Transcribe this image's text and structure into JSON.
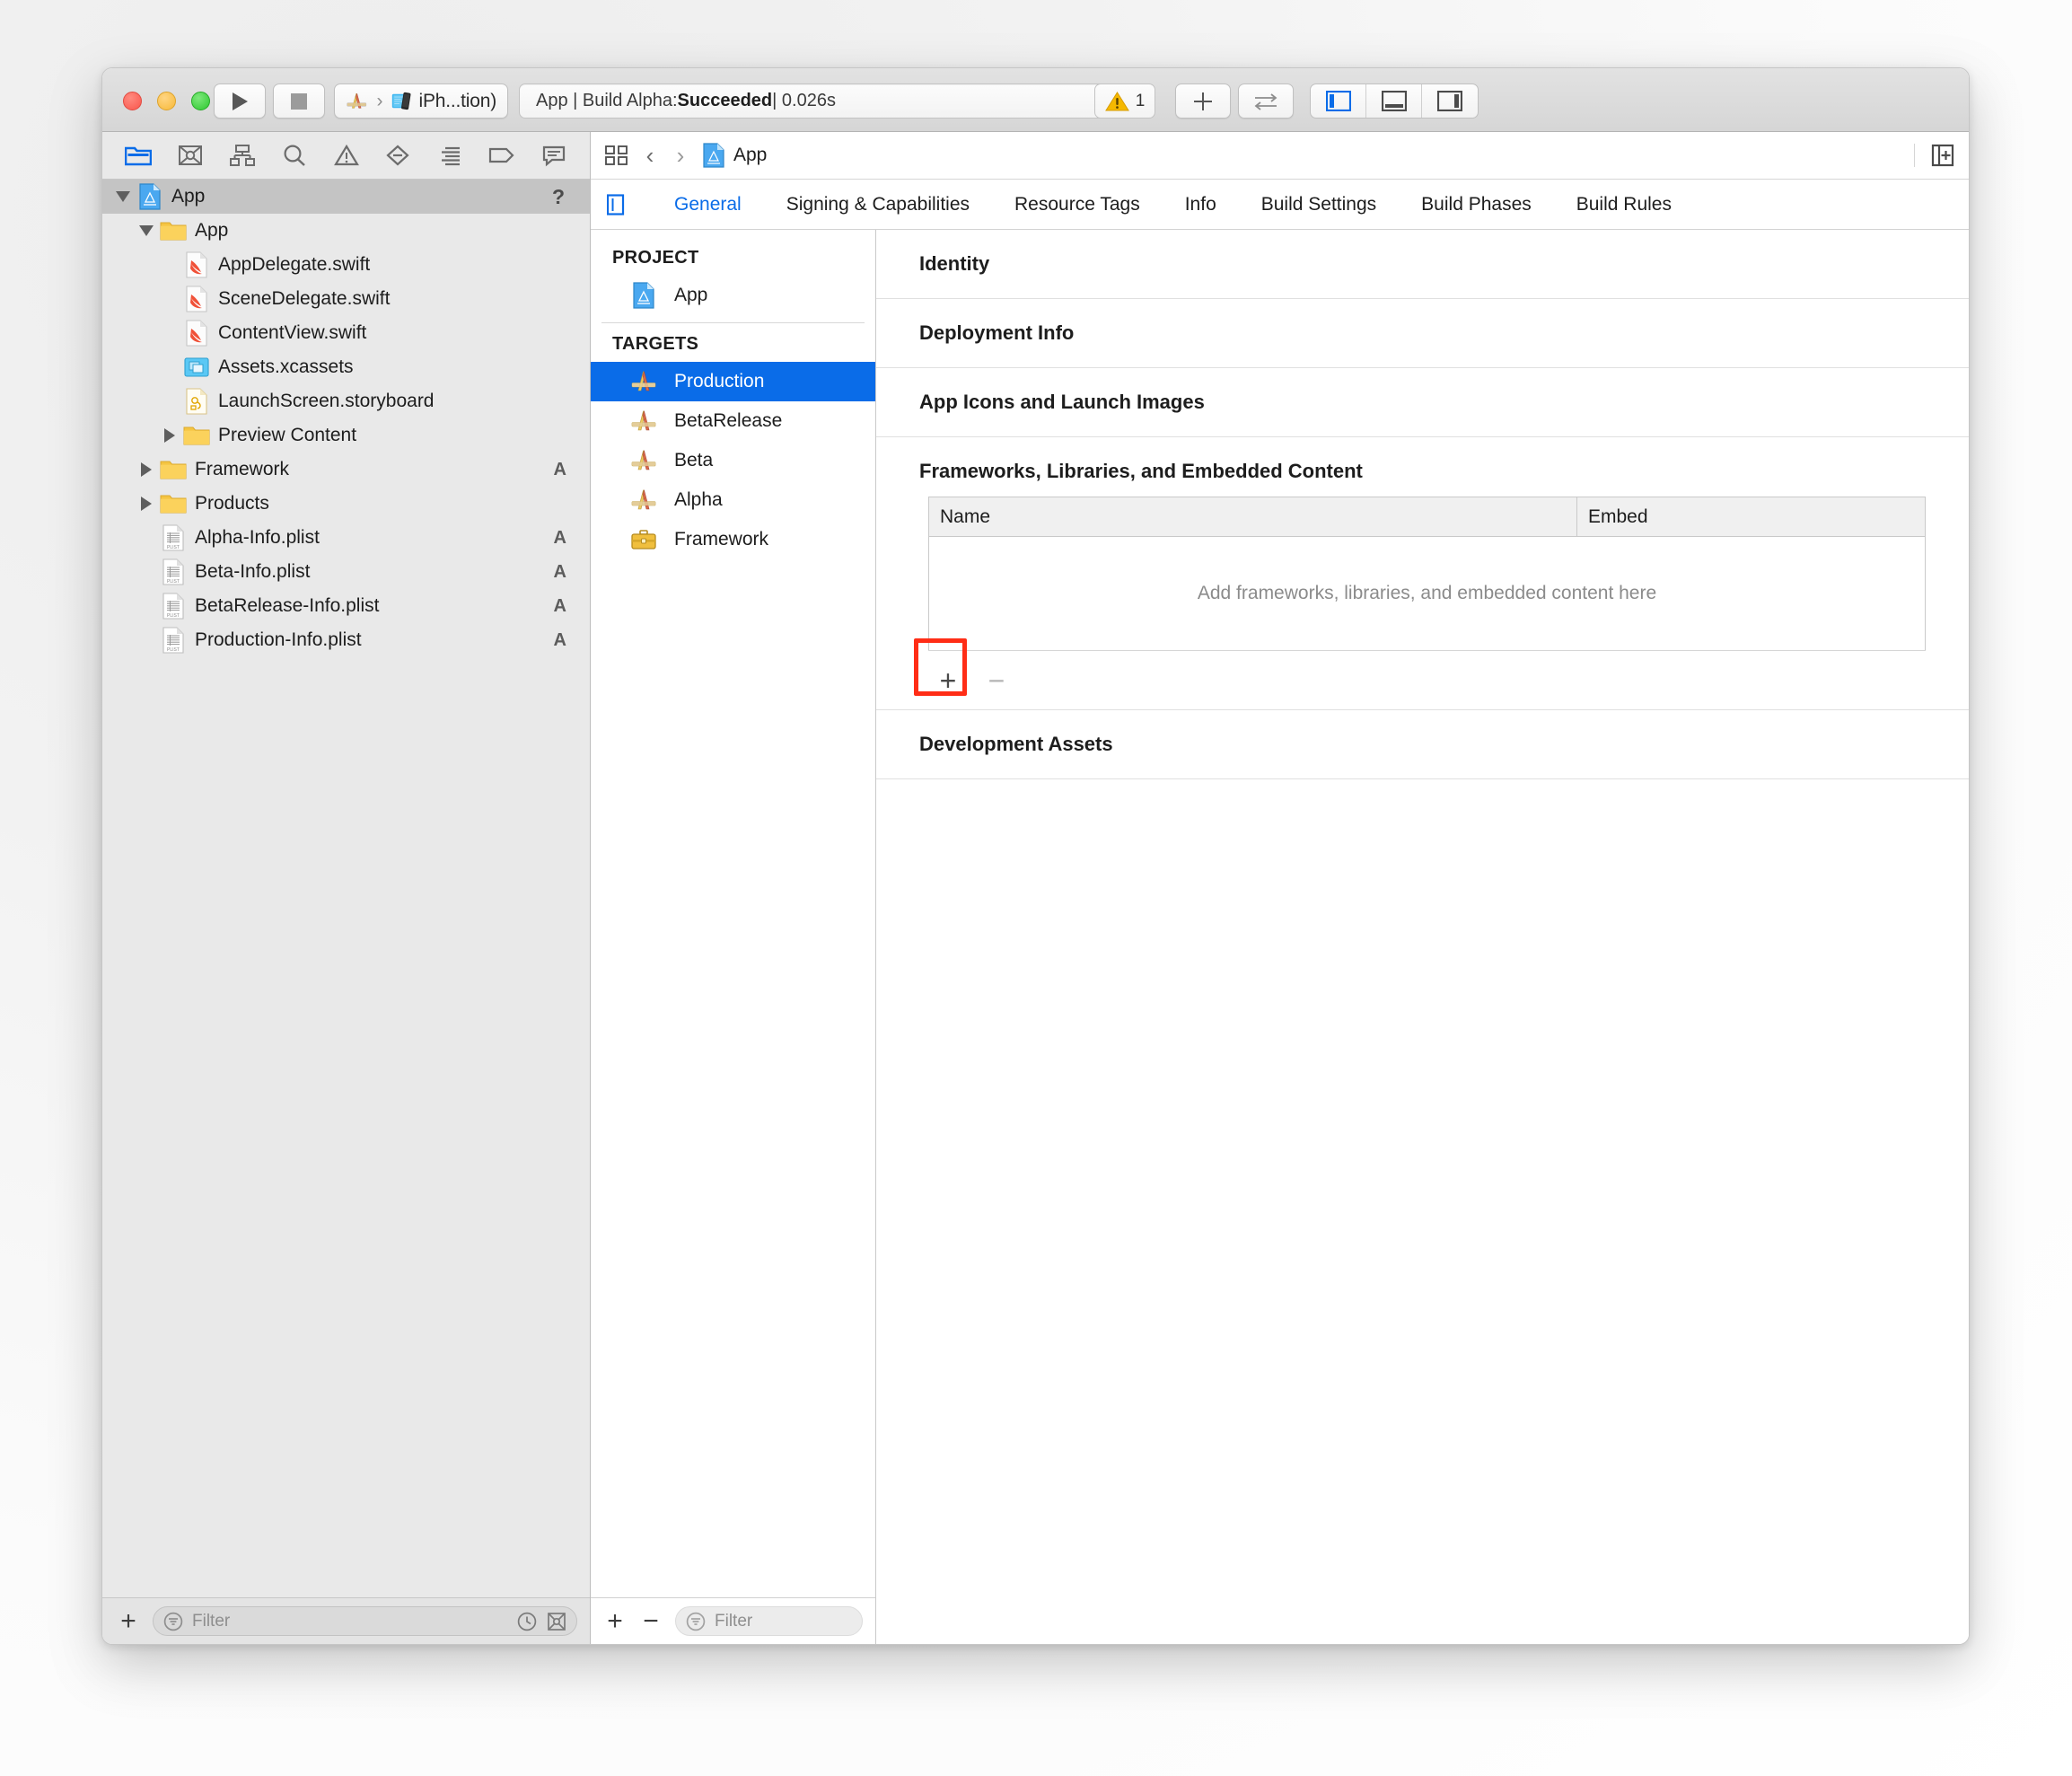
{
  "window": {
    "traffic_lights": [
      "close",
      "minimize",
      "zoom"
    ],
    "toolbar": {
      "run_label": "Run",
      "stop_label": "Stop",
      "scheme_label": "iPh...tion)",
      "scheme_icon": "xcode-scheme-icon",
      "destination_icon": "iphone-simulator-icon",
      "status_prefix": "App | Build Alpha: ",
      "status_result": "Succeeded",
      "status_suffix": " | 0.026s",
      "warning_count": "1",
      "add_label": "+",
      "swap_label": "⇄",
      "panel_left_label": "Navigator",
      "panel_bottom_label": "Debug Area",
      "panel_right_label": "Inspector",
      "accent_blue": "#0a6ce8",
      "warning_yellow": "#f5b800"
    }
  },
  "navigator": {
    "icons": [
      {
        "name": "folder-icon",
        "label": "Project Navigator",
        "active": true
      },
      {
        "name": "sourcecontrol-icon",
        "label": "Source Control Navigator",
        "active": false
      },
      {
        "name": "hierarchy-icon",
        "label": "Symbol Navigator",
        "active": false
      },
      {
        "name": "search-icon",
        "label": "Find Navigator",
        "active": false
      },
      {
        "name": "warning-triangle-icon",
        "label": "Issue Navigator",
        "active": false
      },
      {
        "name": "diamond-minus-icon",
        "label": "Test Navigator",
        "active": false
      },
      {
        "name": "lines-icon",
        "label": "Debug Navigator",
        "active": false
      },
      {
        "name": "tag-icon",
        "label": "Breakpoint Navigator",
        "active": false
      },
      {
        "name": "speech-bubble-icon",
        "label": "Report Navigator",
        "active": false
      }
    ],
    "tree": [
      {
        "label": "App",
        "icon": "xcodeproj-icon",
        "indent": 0,
        "twisty": "down",
        "selected": true,
        "badge": "?",
        "badge_kind": "help"
      },
      {
        "label": "App",
        "icon": "folder-yellow-icon",
        "indent": 1,
        "twisty": "down",
        "selected": false,
        "badge": ""
      },
      {
        "label": "AppDelegate.swift",
        "icon": "swift-file-icon",
        "indent": 2,
        "twisty": "none",
        "selected": false,
        "badge": ""
      },
      {
        "label": "SceneDelegate.swift",
        "icon": "swift-file-icon",
        "indent": 2,
        "twisty": "none",
        "selected": false,
        "badge": ""
      },
      {
        "label": "ContentView.swift",
        "icon": "swift-file-icon",
        "indent": 2,
        "twisty": "none",
        "selected": false,
        "badge": ""
      },
      {
        "label": "Assets.xcassets",
        "icon": "xcassets-icon",
        "indent": 2,
        "twisty": "none",
        "selected": false,
        "badge": ""
      },
      {
        "label": "LaunchScreen.storyboard",
        "icon": "storyboard-icon",
        "indent": 2,
        "twisty": "none",
        "selected": false,
        "badge": ""
      },
      {
        "label": "Preview Content",
        "icon": "folder-yellow-icon",
        "indent": 2,
        "twisty": "right",
        "selected": false,
        "badge": ""
      },
      {
        "label": "Framework",
        "icon": "folder-yellow-icon",
        "indent": 1,
        "twisty": "right",
        "selected": false,
        "badge": "A"
      },
      {
        "label": "Products",
        "icon": "folder-yellow-icon",
        "indent": 1,
        "twisty": "right",
        "selected": false,
        "badge": ""
      },
      {
        "label": "Alpha-Info.plist",
        "icon": "plist-icon",
        "indent": 1,
        "twisty": "none",
        "selected": false,
        "badge": "A"
      },
      {
        "label": "Beta-Info.plist",
        "icon": "plist-icon",
        "indent": 1,
        "twisty": "none",
        "selected": false,
        "badge": "A"
      },
      {
        "label": "BetaRelease-Info.plist",
        "icon": "plist-icon",
        "indent": 1,
        "twisty": "none",
        "selected": false,
        "badge": "A"
      },
      {
        "label": "Production-Info.plist",
        "icon": "plist-icon",
        "indent": 1,
        "twisty": "none",
        "selected": false,
        "badge": "A"
      }
    ],
    "bottom": {
      "add_label": "+",
      "filter_placeholder": "Filter",
      "recent_icon": "clock-icon",
      "sourcecontrol_icon": "sourcecontrol-filter-icon"
    }
  },
  "editor": {
    "jumpbar": {
      "related_icon": "related-items-icon",
      "back_label": "‹",
      "forward_label": "›",
      "breadcrumb": "App",
      "breadcrumb_icon": "xcodeproj-icon",
      "assistant_icon": "add-editor-icon"
    },
    "tabs": [
      {
        "label": "General",
        "active": true
      },
      {
        "label": "Signing & Capabilities",
        "active": false
      },
      {
        "label": "Resource Tags",
        "active": false
      },
      {
        "label": "Info",
        "active": false
      },
      {
        "label": "Build Settings",
        "active": false
      },
      {
        "label": "Build Phases",
        "active": false
      },
      {
        "label": "Build Rules",
        "active": false
      }
    ],
    "sidebar_toggle_icon": "hide-targets-icon"
  },
  "targets_pane": {
    "project_group_label": "PROJECT",
    "project_items": [
      {
        "label": "App",
        "icon": "xcodeproj-icon",
        "selected": false
      }
    ],
    "targets_group_label": "TARGETS",
    "target_items": [
      {
        "label": "Production",
        "icon": "target-app-icon",
        "selected": true
      },
      {
        "label": "BetaRelease",
        "icon": "target-app-icon",
        "selected": false
      },
      {
        "label": "Beta",
        "icon": "target-app-icon",
        "selected": false
      },
      {
        "label": "Alpha",
        "icon": "target-app-icon",
        "selected": false
      },
      {
        "label": "Framework",
        "icon": "target-framework-icon",
        "selected": false
      }
    ],
    "bottom": {
      "add_label": "+",
      "remove_label": "−",
      "filter_placeholder": "Filter"
    }
  },
  "detail": {
    "sections": [
      {
        "label": "Identity",
        "expanded": false
      },
      {
        "label": "Deployment Info",
        "expanded": false
      },
      {
        "label": "App Icons and Launch Images",
        "expanded": false
      },
      {
        "label": "Frameworks, Libraries, and Embedded Content",
        "expanded": true
      },
      {
        "label": "Development Assets",
        "expanded": false
      }
    ],
    "frameworks": {
      "columns": [
        "Name",
        "Embed"
      ],
      "rows": [],
      "empty_message": "Add frameworks, libraries, and embedded content here",
      "add_label": "+",
      "remove_label": "−",
      "highlight_color": "#ff2d16",
      "highlight_target": "add-framework-button"
    }
  }
}
